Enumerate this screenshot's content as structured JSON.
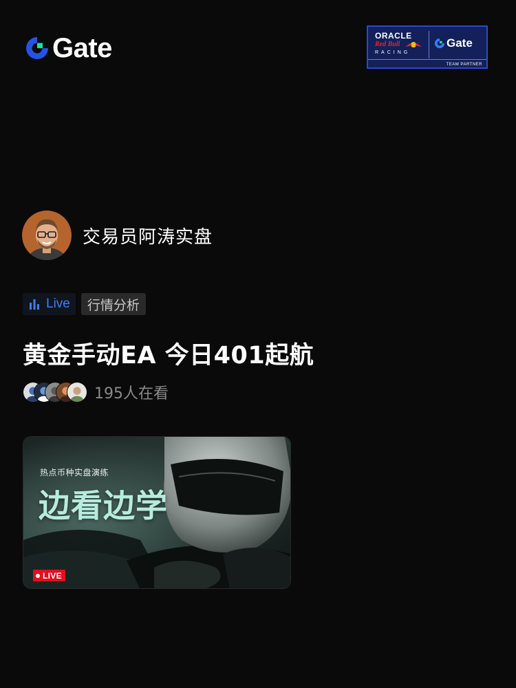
{
  "header": {
    "brand_name": "Gate",
    "partner_badge": {
      "line1": "ORACLE",
      "line2": "Red Bull",
      "line3": "RACING",
      "partner_name": "Gate",
      "caption": "TEAM PARTNER"
    }
  },
  "host": {
    "name": "交易员阿涛实盘"
  },
  "tags": {
    "live_label": "Live",
    "category": "行情分析"
  },
  "stream": {
    "title": "黄金手动EA 今日401起航",
    "viewer_count_text": "195人在看"
  },
  "thumbnail": {
    "subtitle": "热点币种实盘演练",
    "headline": "边看边学",
    "badge": "LIVE"
  },
  "colors": {
    "background": "#0a0a0a",
    "brand_blue": "#2354e6",
    "brand_green": "#17e6a1",
    "live_blue": "#3c7dff",
    "live_red": "#e0101e",
    "muted_text": "#8a8a8a"
  },
  "icons": {
    "brand_logo": "gate-logo-icon",
    "live_indicator": "bar-chart-icon",
    "live_dot": "record-dot-icon"
  }
}
